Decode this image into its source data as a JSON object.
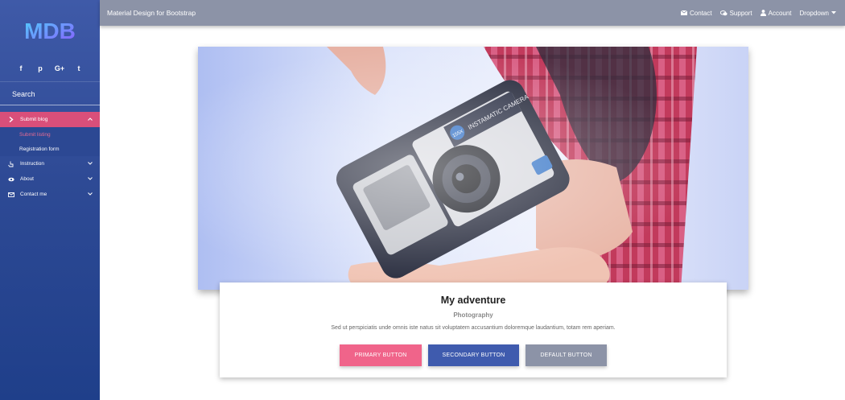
{
  "colors": {
    "sidebar_gradient": [
      "#3f5aa8",
      "#1f3f8a"
    ],
    "active_menu": "#d94f7a",
    "navbar": "#8c93a7",
    "primary": "#f0648a",
    "secondary": "#3f5bae",
    "default": "#8c93a7"
  },
  "sidebar": {
    "logo": "MDB",
    "social_icons": [
      "facebook-icon",
      "pinterest-icon",
      "google-plus-icon",
      "twitter-icon"
    ],
    "social_labels": [
      "f",
      "p",
      "G+",
      "t"
    ],
    "search_placeholder": "Search",
    "menu": [
      {
        "label": "Submit blog",
        "icon": "chevron-right-icon",
        "expanded": true,
        "children": [
          {
            "label": "Submit listing"
          },
          {
            "label": "Registration form"
          }
        ]
      },
      {
        "label": "Instruction",
        "icon": "hand-pointer-icon"
      },
      {
        "label": "About",
        "icon": "eye-icon"
      },
      {
        "label": "Contact me",
        "icon": "envelope-icon"
      }
    ]
  },
  "navbar": {
    "brand": "Material Design for Bootstrap",
    "links": [
      {
        "label": "Contact",
        "icon": "envelope-icon"
      },
      {
        "label": "Support",
        "icon": "comments-icon"
      },
      {
        "label": "Account",
        "icon": "user-icon"
      },
      {
        "label": "Dropdown",
        "icon": "caret-down-icon"
      }
    ]
  },
  "card": {
    "image_alt": "Instamatic camera held in hand",
    "camera_text": "INSTAMATIC CAMERA",
    "camera_badge": "155X",
    "title": "My adventure",
    "subtitle": "Photography",
    "text": "Sed ut perspiciatis unde omnis iste natus sit voluptatem accusantium doloremque laudantium, totam rem aperiam.",
    "buttons": {
      "primary": "PRIMARY BUTTON",
      "secondary": "SECONDARY BUTTON",
      "default": "DEFAULT BUTTON"
    }
  }
}
